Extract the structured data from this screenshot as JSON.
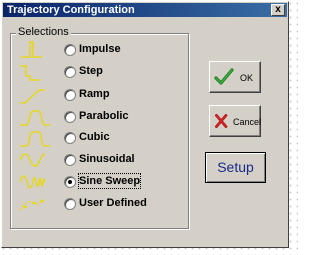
{
  "window": {
    "title": "Trajectory Configuration",
    "close_glyph": "x"
  },
  "group": {
    "label": "Selections"
  },
  "options": [
    {
      "label": "Impulse",
      "icon": "impulse-wave-icon",
      "selected": false
    },
    {
      "label": "Step",
      "icon": "step-wave-icon",
      "selected": false
    },
    {
      "label": "Ramp",
      "icon": "ramp-wave-icon",
      "selected": false
    },
    {
      "label": "Parabolic",
      "icon": "parabolic-wave-icon",
      "selected": false
    },
    {
      "label": "Cubic",
      "icon": "cubic-wave-icon",
      "selected": false
    },
    {
      "label": "Sinusoidal",
      "icon": "sinusoidal-wave-icon",
      "selected": false
    },
    {
      "label": "Sine Sweep",
      "icon": "sine-sweep-wave-icon",
      "selected": true
    },
    {
      "label": "User Defined",
      "icon": "user-defined-wave-icon",
      "selected": false
    }
  ],
  "buttons": {
    "ok": "OK",
    "cancel": "Cancel",
    "setup": "Setup"
  },
  "colors": {
    "icon_yellow": "#e8d800",
    "title_start": "#0a246a",
    "setup_text": "#1a2a8a"
  }
}
